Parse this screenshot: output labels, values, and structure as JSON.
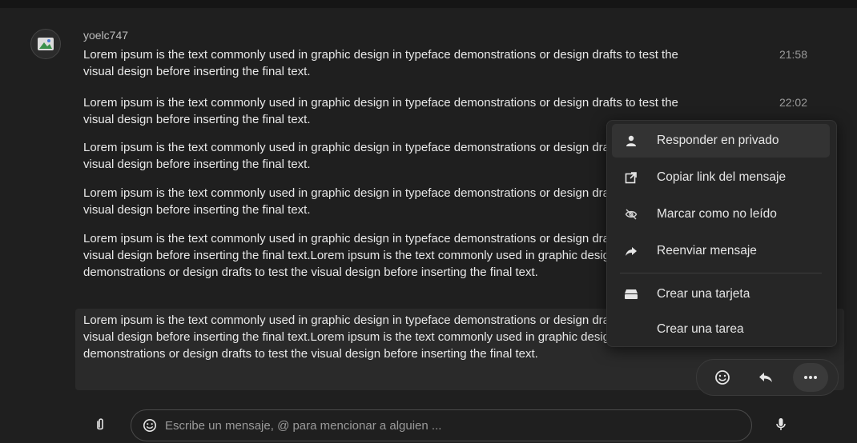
{
  "user": {
    "name": "yoelc747"
  },
  "messages": [
    {
      "text": "Lorem ipsum is the text commonly used in graphic design in typeface demonstrations or design drafts to test the visual design before inserting the final text.",
      "time": "21:58"
    },
    {
      "text": "Lorem ipsum is the text commonly used in graphic design in typeface demonstrations or design drafts to test the visual design before inserting the final text.",
      "time": "22:02"
    },
    {
      "text": "Lorem ipsum is the text commonly used in graphic design in typeface demonstrations or design drafts to test the visual design before inserting the final text.",
      "time": ""
    },
    {
      "text": "Lorem ipsum is the text commonly used in graphic design in typeface demonstrations or design drafts to test the visual design before inserting the final text.",
      "time": ""
    },
    {
      "text": "Lorem ipsum is the text commonly used in graphic design in typeface demonstrations or design drafts to test the visual design before inserting the final text.Lorem ipsum is the text commonly used in graphic design in typeface demonstrations or design drafts to test the visual design before inserting the final text.",
      "time": ""
    },
    {
      "text": "Lorem ipsum is the text commonly used in graphic design in typeface demonstrations or design drafts to test the visual design before inserting the final text.Lorem ipsum is the text commonly used in graphic design in typeface demonstrations or design drafts to test the visual design before inserting the final text.",
      "time": ""
    }
  ],
  "context_menu": {
    "items": [
      {
        "label": "Responder en privado",
        "icon": "person-icon"
      },
      {
        "label": "Copiar link del mensaje",
        "icon": "external-link-icon"
      },
      {
        "label": "Marcar como no leído",
        "icon": "eye-off-icon"
      },
      {
        "label": "Reenviar mensaje",
        "icon": "forward-icon"
      },
      {
        "label": "Crear una tarjeta",
        "icon": "card-icon"
      },
      {
        "label": "Crear una tarea",
        "icon": ""
      }
    ]
  },
  "action_bar": {
    "icons": [
      "emoji-icon",
      "reply-icon",
      "more-icon"
    ]
  },
  "composer": {
    "placeholder": "Escribe un mensaje, @ para mencionar a alguien ..."
  },
  "colors": {
    "background": "#1f1f1f",
    "menu": "#262626",
    "text": "#e6e6e6",
    "muted": "#9a9a9a"
  }
}
